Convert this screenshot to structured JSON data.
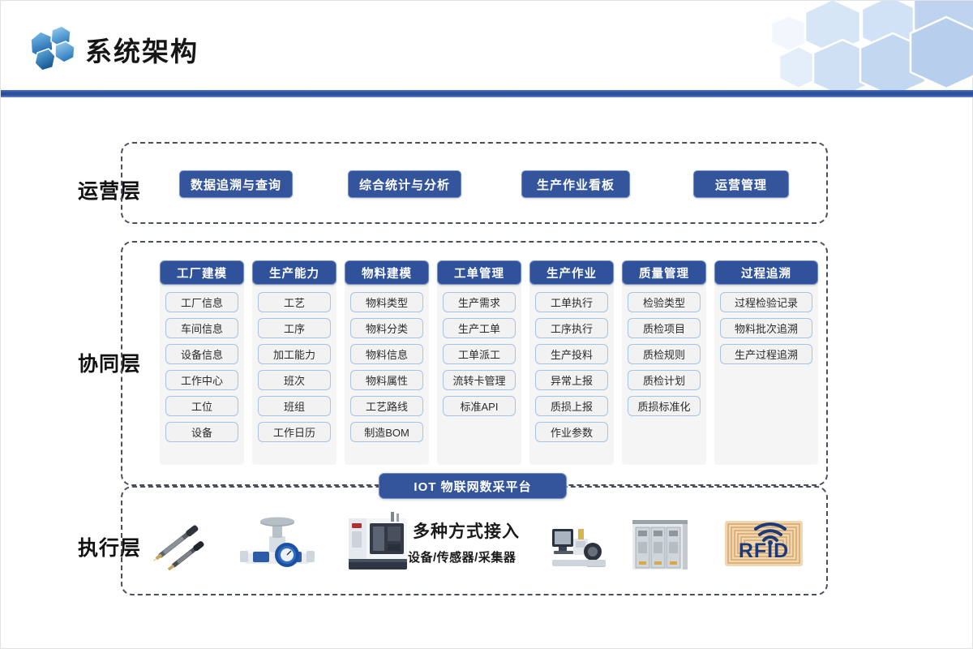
{
  "header": {
    "title": "系统架构",
    "logo_icon": "hexagon-cluster-logo",
    "deco_icon": "hexagon-pattern-decoration"
  },
  "colors": {
    "accent_blue": "#34559c",
    "header_bar": "#2b4f9e",
    "column_head": "#2f529b",
    "pill_border": "#a9c2e4",
    "panel_bg": "#f5f5f5",
    "dashed_border": "#4a4f5c",
    "rfid_bg": "#f0d7b4",
    "rfid_text": "#1b3a7a"
  },
  "layers": {
    "operation": {
      "label": "运营层",
      "buttons": [
        {
          "label": "数据追溯与查询"
        },
        {
          "label": "综合统计与分析"
        },
        {
          "label": "生产作业看板"
        },
        {
          "label": "运营管理"
        }
      ]
    },
    "collaboration": {
      "label": "协同层",
      "columns": [
        {
          "title": "工厂建模",
          "items": [
            "工厂信息",
            "车间信息",
            "设备信息",
            "工作中心",
            "工位",
            "设备"
          ]
        },
        {
          "title": "生产能力",
          "items": [
            "工艺",
            "工序",
            "加工能力",
            "班次",
            "班组",
            "工作日历"
          ]
        },
        {
          "title": "物料建模",
          "items": [
            "物料类型",
            "物料分类",
            "物料信息",
            "物料属性",
            "工艺路线",
            "制造BOM"
          ]
        },
        {
          "title": "工单管理",
          "items": [
            "生产需求",
            "生产工单",
            "工单派工",
            "流转卡管理",
            "标准API"
          ]
        },
        {
          "title": "生产作业",
          "items": [
            "工单执行",
            "工序执行",
            "生产投料",
            "异常上报",
            "质损上报",
            "作业参数"
          ]
        },
        {
          "title": "质量管理",
          "items": [
            "检验类型",
            "质检项目",
            "质检规则",
            "质检计划",
            "质损标准化"
          ]
        },
        {
          "title": "过程追溯",
          "items": [
            "过程检验记录",
            "物料批次追溯",
            "生产过程追溯"
          ]
        }
      ]
    },
    "iot_banner": {
      "label": "IOT 物联网数采平台"
    },
    "execution": {
      "label": "执行层",
      "text_main": "多种方式接入",
      "text_sub": "设备/传感器/采集器",
      "rfid_label": "RFID",
      "devices": [
        {
          "name": "probe-sensor-device"
        },
        {
          "name": "flow-meter-valve-device"
        },
        {
          "name": "cnc-machine-device"
        },
        {
          "name": "industrial-workstation-device"
        },
        {
          "name": "control-cabinet-device"
        },
        {
          "name": "rfid-tag-device"
        }
      ]
    }
  }
}
